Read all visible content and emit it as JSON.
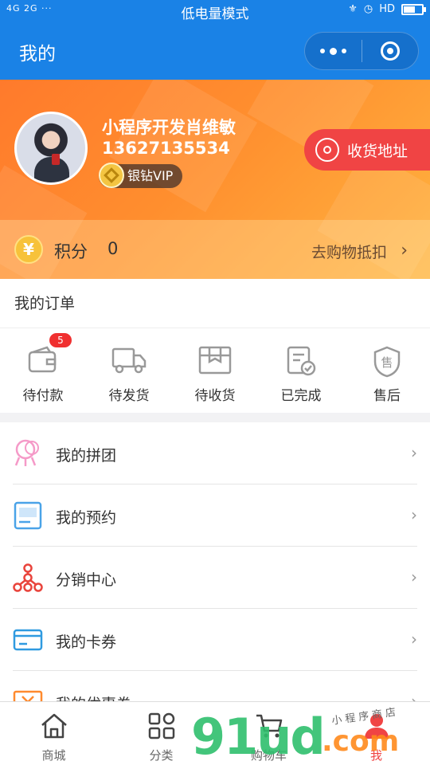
{
  "status_bar": {
    "left": "4G 2G ···",
    "center": "低电量模式",
    "right": "HD"
  },
  "nav": {
    "title": "我的"
  },
  "profile": {
    "name": "小程序开发肖维敏",
    "phone": "13627135534",
    "vip_label": "银钻VIP",
    "address_button": "收货地址"
  },
  "points": {
    "coin_symbol": "¥",
    "label": "积分",
    "value": "0",
    "link": "去购物抵扣"
  },
  "orders": {
    "title": "我的订单",
    "items": [
      {
        "label": "待付款",
        "icon": "wallet-icon",
        "badge": "5"
      },
      {
        "label": "待发货",
        "icon": "truck-icon"
      },
      {
        "label": "待收货",
        "icon": "box-icon"
      },
      {
        "label": "已完成",
        "icon": "done-document-icon"
      },
      {
        "label": "售后",
        "icon": "shield-icon",
        "glyph": "售"
      }
    ]
  },
  "menu": [
    {
      "label": "我的拼团",
      "icon": "group-icon"
    },
    {
      "label": "我的预约",
      "icon": "reservation-icon"
    },
    {
      "label": "分销中心",
      "icon": "network-icon"
    },
    {
      "label": "我的卡券",
      "icon": "card-icon"
    },
    {
      "label": "我的优惠券",
      "icon": "coupon-icon"
    }
  ],
  "tabbar": [
    {
      "label": "商城",
      "icon": "home-icon"
    },
    {
      "label": "分类",
      "icon": "category-icon"
    },
    {
      "label": "购物车",
      "icon": "cart-icon"
    },
    {
      "label": "我",
      "icon": "user-icon",
      "active": true
    }
  ],
  "watermark": {
    "number": "91ud",
    "domain": ".com",
    "chinese": "小程序商店"
  },
  "colors": {
    "primary_blue": "#1a82e6",
    "header_orange": "#ff8a2e",
    "accent_red": "#f04444"
  }
}
